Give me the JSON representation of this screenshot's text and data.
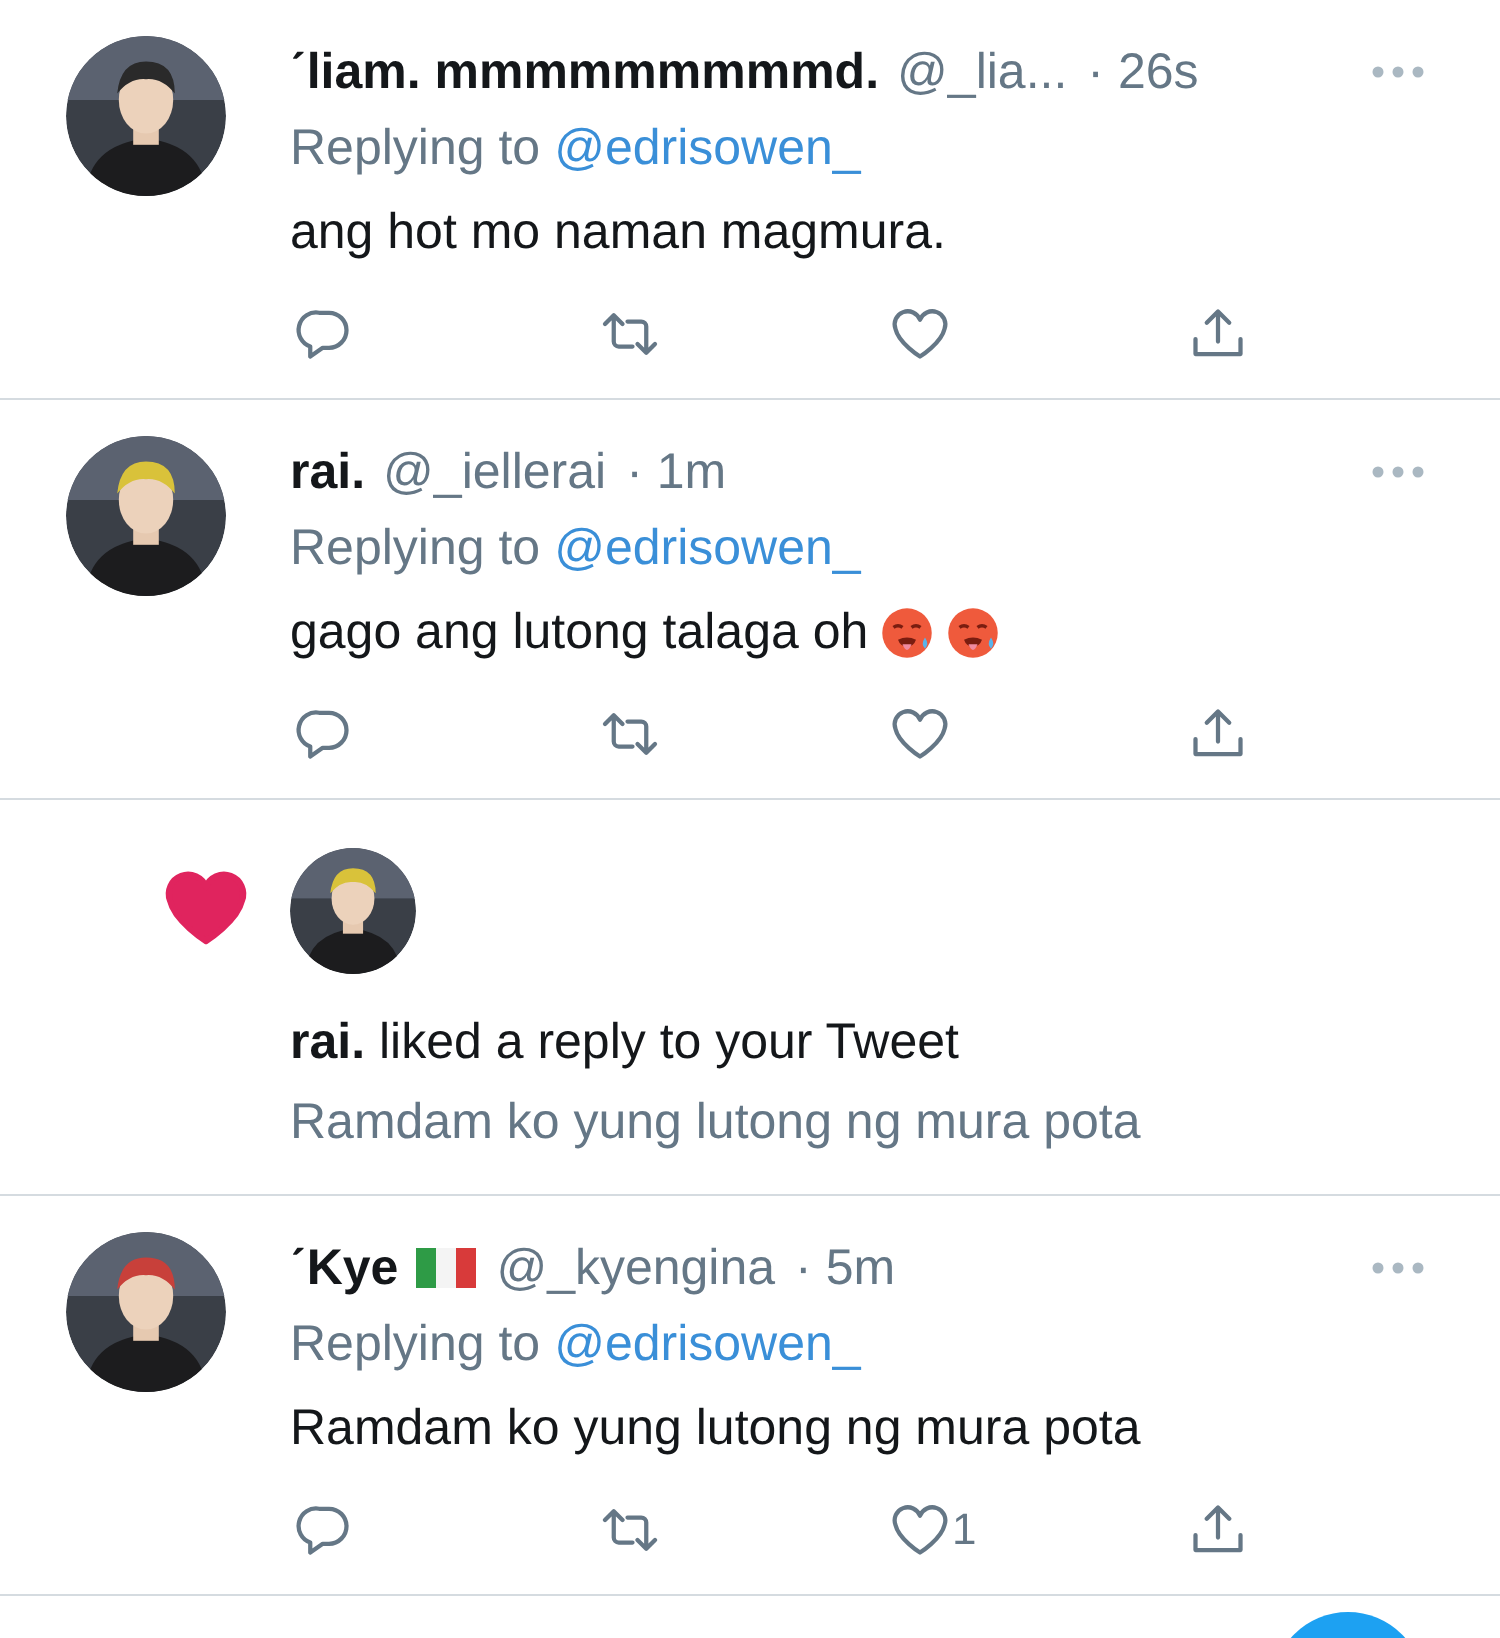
{
  "feed": [
    {
      "kind": "tweet",
      "avatar": {
        "kind": "picture"
      },
      "name": "ˊliam. mmmmmmmmmd.",
      "handle": "@_lia...",
      "time": "· 26s",
      "replying_label": "Replying to",
      "replying_to": "@edrisowen_",
      "text": "ang hot mo naman magmura.",
      "liked": false
    },
    {
      "kind": "tweet",
      "avatar": {
        "kind": "picture"
      },
      "name": "rai.",
      "handle": "@_iellerai",
      "time": "· 1m",
      "replying_label": "Replying to",
      "replying_to": "@edrisowen_",
      "text": "gago ang lutong talaga oh",
      "emojis": [
        {
          "kind": "hot_face"
        },
        {
          "kind": "hot_face"
        }
      ],
      "liked": false
    },
    {
      "kind": "like_notification",
      "avatar": {
        "kind": "picture"
      },
      "actor": "rai.",
      "message": "liked a reply to your Tweet",
      "quote": "Ramdam ko yung lutong ng mura pota"
    },
    {
      "kind": "tweet",
      "avatar": {
        "kind": "picture"
      },
      "name": "ˊKye",
      "name_badges": [
        {
          "kind": "flag_it"
        }
      ],
      "handle": "@_kyengina",
      "time": "· 5m",
      "replying_label": "Replying to",
      "replying_to": "@edrisowen_",
      "text": "Ramdam ko yung lutong ng mura pota",
      "liked": false,
      "like_count": "1"
    }
  ],
  "compose_button": {
    "kind": "fab"
  }
}
